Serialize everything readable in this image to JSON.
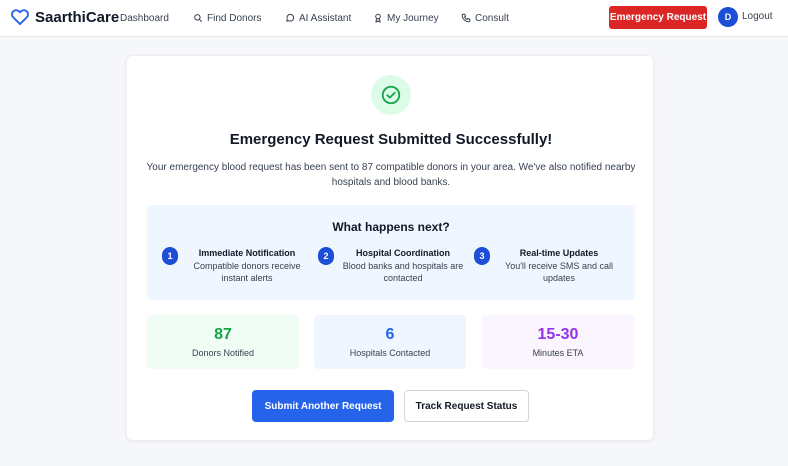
{
  "brand": {
    "name": "SaarthiCare",
    "logo_icon": "heart-icon",
    "color": "#2563eb"
  },
  "nav": {
    "items": [
      {
        "label": "Dashboard",
        "icon": null
      },
      {
        "label": "Find Donors",
        "icon": "search-icon"
      },
      {
        "label": "AI Assistant",
        "icon": "chat-bubble-icon"
      },
      {
        "label": "My Journey",
        "icon": "award-icon"
      },
      {
        "label": "Consult",
        "icon": "phone-icon"
      }
    ],
    "emergency_label": "Emergency Request",
    "emergency_color": "#dc2626",
    "avatar_initial": "D",
    "logout_label": "Logout"
  },
  "success": {
    "icon": "check-circle-icon",
    "title": "Emergency Request Submitted Successfully!",
    "description": "Your emergency blood request has been sent to 87 compatible donors in your area. We've also notified nearby hospitals and blood banks."
  },
  "next": {
    "title": "What happens next?",
    "steps": [
      {
        "num": "1",
        "title": "Immediate Notification",
        "desc": "Compatible donors receive instant alerts"
      },
      {
        "num": "2",
        "title": "Hospital Coordination",
        "desc": "Blood banks and hospitals are contacted"
      },
      {
        "num": "3",
        "title": "Real-time Updates",
        "desc": "You'll receive SMS and call updates"
      }
    ]
  },
  "stats": [
    {
      "value": "87",
      "label": "Donors Notified",
      "color": "#16a34a",
      "bg": "#f0fdf4"
    },
    {
      "value": "6",
      "label": "Hospitals Contacted",
      "color": "#2563eb",
      "bg": "#eff6ff"
    },
    {
      "value": "15-30",
      "label": "Minutes ETA",
      "color": "#9333ea",
      "bg": "#faf5ff"
    }
  ],
  "actions": {
    "primary_label": "Submit Another Request",
    "secondary_label": "Track Request Status"
  }
}
